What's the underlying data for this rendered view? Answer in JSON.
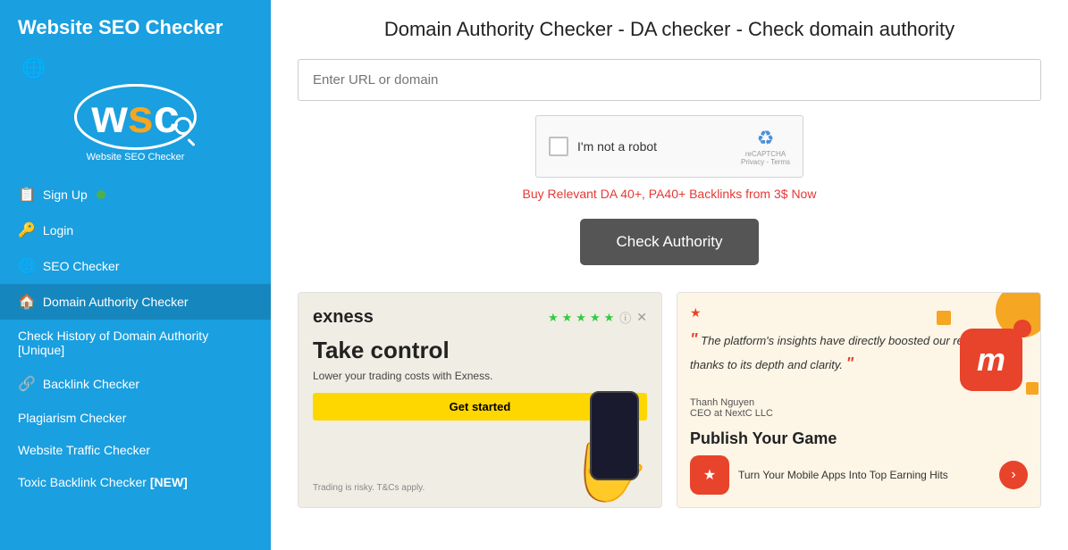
{
  "sidebar": {
    "title": "Website SEO Checker",
    "logo_subtitle": "Website SEO Checker",
    "nav_items": [
      {
        "id": "signup",
        "label": "Sign Up",
        "icon": "📋",
        "badge": true,
        "active": false
      },
      {
        "id": "login",
        "label": "Login",
        "icon": "🔑",
        "badge": false,
        "active": false
      },
      {
        "id": "seo-checker",
        "label": "SEO Checker",
        "icon": "🌐",
        "badge": false,
        "active": false
      },
      {
        "id": "domain-authority",
        "label": "Domain Authority Checker",
        "icon": "🏠",
        "badge": false,
        "active": true
      },
      {
        "id": "check-history",
        "label": "Check History of Domain Authority [Unique]",
        "icon": "",
        "badge": false,
        "active": false
      },
      {
        "id": "backlink-checker",
        "label": "Backlink Checker",
        "icon": "🔗",
        "badge": false,
        "active": false
      },
      {
        "id": "plagiarism-checker",
        "label": "Plagiarism Checker",
        "icon": "",
        "badge": false,
        "active": false
      },
      {
        "id": "website-traffic",
        "label": "Website Traffic Checker",
        "icon": "",
        "badge": false,
        "active": false
      },
      {
        "id": "toxic-backlink",
        "label": "Toxic Backlink Checker",
        "icon": "",
        "badge": false,
        "active": false,
        "tag": "[NEW]"
      }
    ]
  },
  "main": {
    "page_title": "Domain Authority Checker - DA checker - Check domain authority",
    "url_input_placeholder": "Enter URL or domain",
    "captcha_label": "I'm not a robot",
    "captcha_badge_top": "reCAPTCHA",
    "captcha_badge_bottom": "Privacy - Terms",
    "promo_text": "Buy Relevant DA 40+, PA40+ Backlinks from 3$ Now",
    "check_button": "Check Authority",
    "ads": {
      "left": {
        "brand": "exness",
        "stars": "★★★★★",
        "title": "Take control",
        "subtitle": "Lower your trading costs with Exness.",
        "cta": "Get started",
        "disclaimer": "Trading is risky. T&Cs apply."
      },
      "right": {
        "quote": "\"The platform's insights have directly boosted our revenue, thanks to its depth and clarity.\"",
        "author": "Thanh Nguyen",
        "author_role": "CEO at NextC LLC",
        "title": "Publish Your Game",
        "app_desc": "Turn Your Mobile Apps Into Top Earning Hits",
        "m_icon": "m"
      }
    }
  }
}
